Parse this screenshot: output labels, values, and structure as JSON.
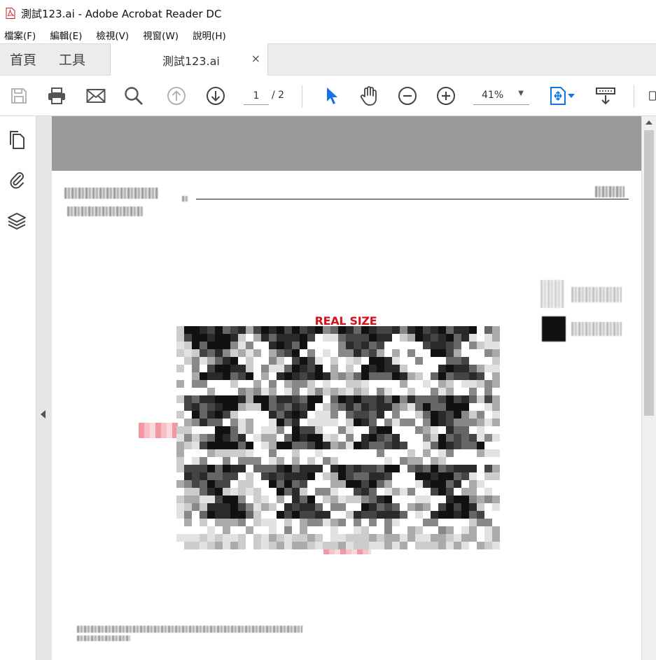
{
  "window": {
    "title": "測試123.ai - Adobe Acrobat Reader DC"
  },
  "menu": [
    {
      "label": "檔案(F)"
    },
    {
      "label": "編輯(E)"
    },
    {
      "label": "檢視(V)"
    },
    {
      "label": "視窗(W)"
    },
    {
      "label": "說明(H)"
    }
  ],
  "tabs": {
    "home": "首頁",
    "tools": "工具",
    "document": "測試123.ai",
    "close": "×"
  },
  "toolbar": {
    "page_current": "1",
    "page_total": "/ 2",
    "zoom": "41%"
  },
  "document": {
    "real_size_line1": "REAL SIZE",
    "real_size_line2": "100%"
  },
  "colors": {
    "accent": "#1473e6",
    "real_size_red": "#d3141c",
    "viewer_bg": "#9a9a9a"
  }
}
